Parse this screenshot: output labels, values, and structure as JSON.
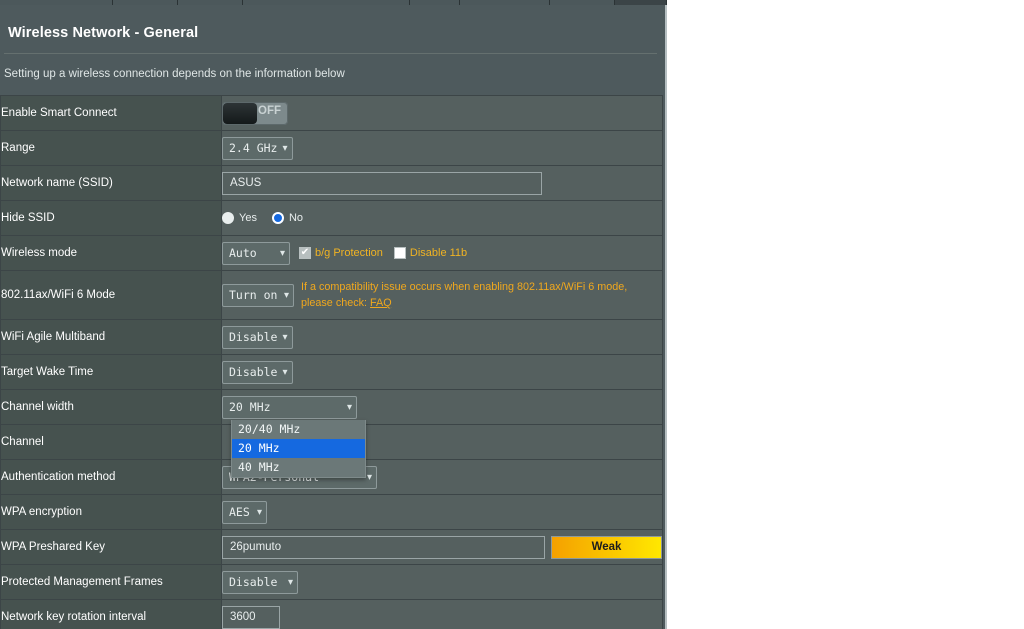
{
  "page": {
    "title": "Wireless Network - General",
    "description": "Setting up a wireless connection depends on the information below"
  },
  "rows": {
    "smart_connect": {
      "label": "Enable Smart Connect",
      "toggle_state": "OFF"
    },
    "range": {
      "label": "Range",
      "value": "2.4 GHz"
    },
    "ssid": {
      "label": "Network name (SSID)",
      "value": "ASUS"
    },
    "hide_ssid": {
      "label": "Hide SSID",
      "yes_label": "Yes",
      "no_label": "No",
      "selected": "No"
    },
    "wireless_mode": {
      "label": "Wireless mode",
      "value": "Auto",
      "bg_protection_label": "b/g Protection",
      "bg_protection_checked": true,
      "disable_11b_label": "Disable 11b",
      "disable_11b_checked": false
    },
    "ax_mode": {
      "label": "802.11ax/WiFi 6 Mode",
      "value": "Turn on",
      "warning_line1": "If a compatibility issue occurs when enabling 802.11ax/WiFi 6 mode,",
      "warning_line2_prefix": "please check: ",
      "warning_link": "FAQ"
    },
    "agile_multiband": {
      "label": "WiFi Agile Multiband",
      "value": "Disable"
    },
    "target_wake_time": {
      "label": "Target Wake Time",
      "value": "Disable"
    },
    "channel_width": {
      "label": "Channel width",
      "value": "20 MHz",
      "open": true,
      "options": [
        "20/40 MHz",
        "20 MHz",
        "40 MHz"
      ],
      "selected_option": "20 MHz"
    },
    "channel": {
      "label": "Channel"
    },
    "auth_method": {
      "label": "Authentication method",
      "value": "WPA2-Personal"
    },
    "wpa_encryption": {
      "label": "WPA encryption",
      "value": "AES"
    },
    "wpa_psk": {
      "label": "WPA Preshared Key",
      "value": "26pumuto",
      "strength_badge": "Weak"
    },
    "pmf": {
      "label": "Protected Management Frames",
      "value": "Disable"
    },
    "key_rotation": {
      "label": "Network key rotation interval",
      "value": "3600"
    }
  },
  "colors": {
    "panel_bg": "#4e5a5d",
    "label_col": "#46524f",
    "value_col": "#55605f",
    "accent_warning": "#f0a81e",
    "dropdown_selected": "#1569e0",
    "badge_from": "#f5a000",
    "badge_to": "#ffe800"
  }
}
